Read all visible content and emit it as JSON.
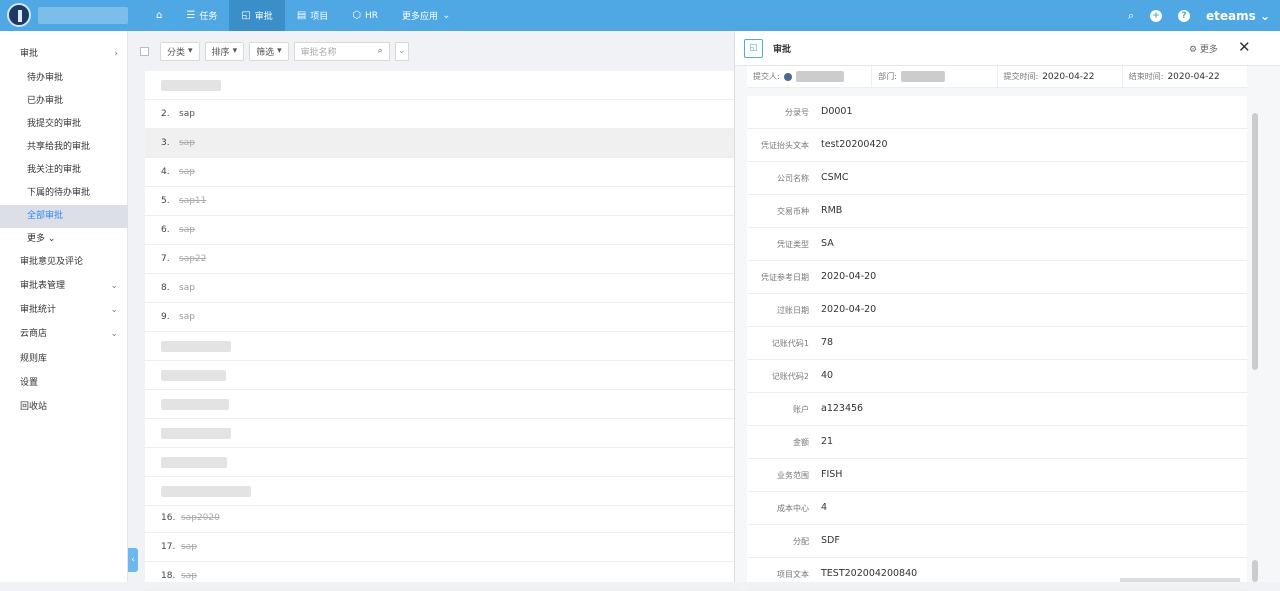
{
  "topbar": {
    "nav": [
      {
        "icon": "home-icon",
        "label": ""
      },
      {
        "icon": "list-icon",
        "label": "任务"
      },
      {
        "icon": "approval-icon",
        "label": "审批"
      },
      {
        "icon": "project-icon",
        "label": "项目"
      },
      {
        "icon": "hr-icon",
        "label": "HR"
      },
      {
        "icon": "",
        "label": "更多应用"
      }
    ],
    "brand": "eteams",
    "help": "?"
  },
  "sidebar": {
    "items": [
      {
        "label": "审批",
        "chev": "›"
      },
      {
        "label": "待办审批",
        "chev": ""
      },
      {
        "label": "已办审批",
        "chev": ""
      },
      {
        "label": "我提交的审批",
        "chev": ""
      },
      {
        "label": "共享给我的审批",
        "chev": ""
      },
      {
        "label": "我关注的审批",
        "chev": ""
      },
      {
        "label": "下属的待办审批",
        "chev": ""
      },
      {
        "label": "全部审批",
        "chev": ""
      },
      {
        "label": "更多",
        "chev": ""
      },
      {
        "label": "审批意见及评论",
        "chev": ""
      },
      {
        "label": "审批表管理",
        "chev": "⌄"
      },
      {
        "label": "审批统计",
        "chev": "⌄"
      },
      {
        "label": "云商店",
        "chev": "⌄"
      },
      {
        "label": "规则库",
        "chev": ""
      },
      {
        "label": "设置",
        "chev": ""
      },
      {
        "label": "回收站",
        "chev": ""
      }
    ]
  },
  "toolbar": {
    "category": "分类",
    "sort": "排序",
    "filter": "筛选",
    "search_placeholder": "审批名称"
  },
  "list": {
    "rows": [
      {
        "num": "",
        "title": ""
      },
      {
        "num": "2.",
        "title": "sap"
      },
      {
        "num": "3.",
        "title": "sap"
      },
      {
        "num": "4.",
        "title": "sap"
      },
      {
        "num": "5.",
        "title": "sap11"
      },
      {
        "num": "6.",
        "title": "sap"
      },
      {
        "num": "7.",
        "title": "sap22"
      },
      {
        "num": "8.",
        "title": "sap"
      },
      {
        "num": "9.",
        "title": "sap"
      },
      {
        "num": "",
        "title": ""
      },
      {
        "num": "",
        "title": ""
      },
      {
        "num": "",
        "title": ""
      },
      {
        "num": "",
        "title": ""
      },
      {
        "num": "",
        "title": ""
      },
      {
        "num": "",
        "title": ""
      },
      {
        "num": "16.",
        "title": "sap2020"
      },
      {
        "num": "17.",
        "title": "sap"
      },
      {
        "num": "18.",
        "title": "sap"
      }
    ]
  },
  "panel": {
    "title": "审批",
    "more": "⚙ 更多",
    "close": "✕",
    "meta": {
      "submitter_label": "提交人:",
      "dept_label": "部门:",
      "submit_time_label": "提交时间:",
      "submit_time": "2020-04-22",
      "end_time_label": "结束时间:",
      "end_time": "2020-04-22"
    },
    "fields": [
      {
        "label": "分录号",
        "value": "D0001"
      },
      {
        "label": "凭证抬头文本",
        "value": "test20200420"
      },
      {
        "label": "公司名称",
        "value": "CSMC"
      },
      {
        "label": "交易币种",
        "value": "RMB"
      },
      {
        "label": "凭证类型",
        "value": "SA"
      },
      {
        "label": "凭证参考日期",
        "value": "2020-04-20"
      },
      {
        "label": "过账日期",
        "value": "2020-04-20"
      },
      {
        "label": "记账代码1",
        "value": "78"
      },
      {
        "label": "记账代码2",
        "value": "40"
      },
      {
        "label": "账户",
        "value": "a123456"
      },
      {
        "label": "金额",
        "value": "21"
      },
      {
        "label": "业务范围",
        "value": "FISH"
      },
      {
        "label": "成本中心",
        "value": "4"
      },
      {
        "label": "分配",
        "value": "SDF"
      },
      {
        "label": "项目文本",
        "value": "TEST202004200840"
      }
    ]
  }
}
